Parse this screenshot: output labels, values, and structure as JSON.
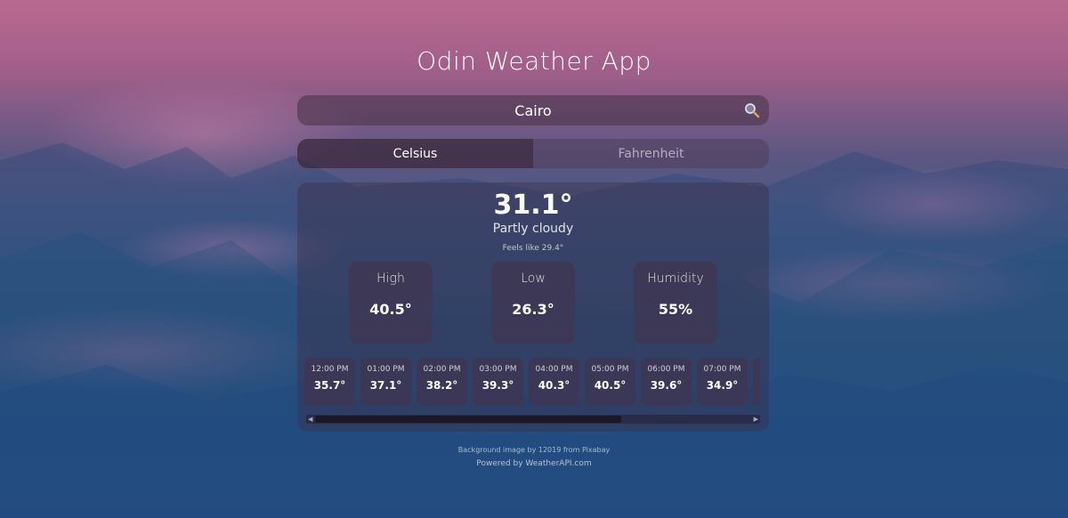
{
  "app": {
    "title": "Odin Weather App"
  },
  "search": {
    "value": "Cairo",
    "icon": "search-icon"
  },
  "units": {
    "celsius_label": "Celsius",
    "fahrenheit_label": "Fahrenheit",
    "selected": "Celsius"
  },
  "current": {
    "temperature": "31.1°",
    "condition": "Partly cloudy",
    "feels_like": "Feels like 29.4°"
  },
  "stats": [
    {
      "label": "High",
      "value": "40.5°"
    },
    {
      "label": "Low",
      "value": "26.3°"
    },
    {
      "label": "Humidity",
      "value": "55%"
    }
  ],
  "hourly": [
    {
      "time": "12:00 PM",
      "temp": "35.7°"
    },
    {
      "time": "01:00 PM",
      "temp": "37.1°"
    },
    {
      "time": "02:00 PM",
      "temp": "38.2°"
    },
    {
      "time": "03:00 PM",
      "temp": "39.3°"
    },
    {
      "time": "04:00 PM",
      "temp": "40.3°"
    },
    {
      "time": "05:00 PM",
      "temp": "40.5°"
    },
    {
      "time": "06:00 PM",
      "temp": "39.6°"
    },
    {
      "time": "07:00 PM",
      "temp": "34.9°"
    }
  ],
  "hourly_scroll_position": 0,
  "footer": {
    "image_credit": "Background image by 12019 from Pixabay",
    "powered_by": "Powered by WeatherAPI.com"
  },
  "colors": {
    "accent_dark": "#3c283c",
    "text": "#ffffff"
  }
}
